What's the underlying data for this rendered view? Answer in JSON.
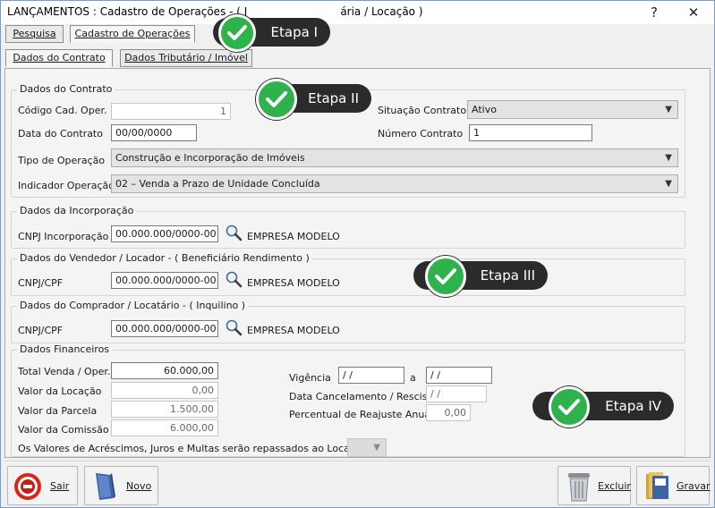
{
  "window": {
    "title": "LANÇAMENTOS : Cadastro de Operações - ( I",
    "title_tail": "ária / Locação )",
    "help": "?",
    "close": "✕"
  },
  "tabs": [
    {
      "label": "Pesquisa"
    },
    {
      "label": "Cadastro de Operações"
    }
  ],
  "subtabs": [
    {
      "label": "Dados do Contrato"
    },
    {
      "label": "Dados Tributário  /  Imóvel"
    }
  ],
  "contrato": {
    "title": "Dados do Contrato",
    "codigo_label": "Código Cad. Oper.",
    "codigo_value": "1",
    "data_label": "Data do Contrato",
    "data_value": "00/00/0000",
    "situacao_label": "Situação Contrato",
    "situacao_value": "Ativo",
    "numero_label": "Número Contrato",
    "numero_value": "1",
    "tipo_label": "Tipo de Operação",
    "tipo_value": "Construção e Incorporação de Imóveis",
    "indicador_label": "Indicador Operação",
    "indicador_value": "02 – Venda a Prazo de Unidade Concluída"
  },
  "incorporacao": {
    "title": "Dados da Incorporação",
    "cnpj_label": "CNPJ Incorporação",
    "cnpj_value": "00.000.000/0000-00",
    "empresa": "EMPRESA MODELO"
  },
  "vendedor": {
    "title": "Dados do Vendedor  /  Locador - ( Beneficiário Rendimento )",
    "cnpj_label": "CNPJ/CPF",
    "cnpj_value": "00.000.000/0000-00",
    "empresa": "EMPRESA MODELO"
  },
  "comprador": {
    "title": "Dados do Comprador  /  Locatário - ( Inquilino )",
    "cnpj_label": "CNPJ/CPF",
    "cnpj_value": "00.000.000/0000-00",
    "empresa": "EMPRESA MODELO"
  },
  "financeiros": {
    "title": "Dados Financeiros",
    "total_label": "Total Venda / Oper.",
    "total_value": "60.000,00",
    "locacao_label": "Valor da Locação",
    "locacao_value": "0,00",
    "parcela_label": "Valor da Parcela",
    "parcela_value": "1.500,00",
    "comissao_label": "Valor da Comissão",
    "comissao_value": "6.000,00",
    "vigencia_label": "Vigência",
    "vigencia_from": " / /",
    "vigencia_sep": "a",
    "vigencia_to": " / /",
    "cancel_label": "Data Cancelamento / Rescisão",
    "cancel_value": " / /",
    "reajuste_label": "Percentual de Reajuste Anual",
    "reajuste_value": "0,00",
    "repasse_label": "Os Valores de Acréscimos, Juros e Multas serão repassados ao Locador"
  },
  "steps": [
    {
      "label": "Etapa I"
    },
    {
      "label": "Etapa II"
    },
    {
      "label": "Etapa III"
    },
    {
      "label": "Etapa IV"
    }
  ],
  "buttons": {
    "sair": "Sair",
    "novo": "Novo",
    "excluir": "Excluir",
    "gravar": "Gravar"
  },
  "colors": {
    "step_badge": "#2b2b2b",
    "step_check": "#2eb24b",
    "sair_icon": "#d9261c"
  }
}
